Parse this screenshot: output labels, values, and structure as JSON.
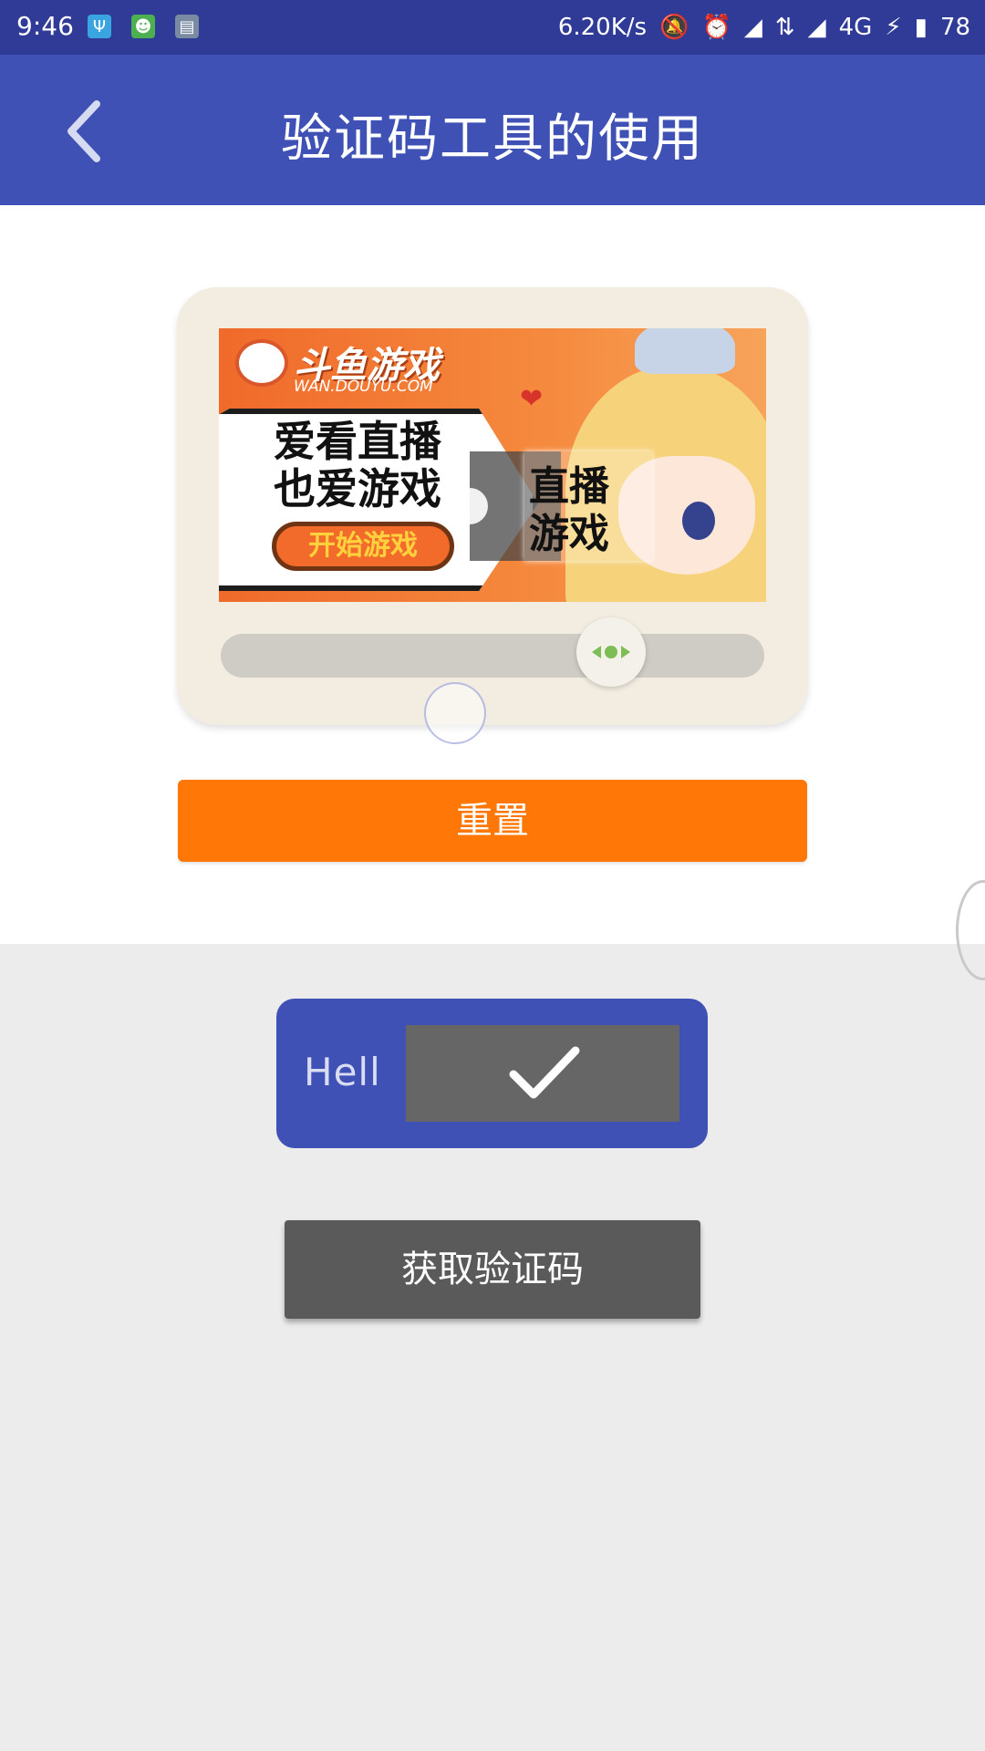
{
  "status_bar": {
    "time": "9:46",
    "network_speed": "6.20K/s",
    "network_type": "4G",
    "battery_level": "78",
    "left_icons": [
      "usb-icon",
      "android-icon",
      "screenshot-icon"
    ],
    "right_icons": [
      "mute-icon",
      "alarm-icon",
      "signal-icon",
      "data-transfer-icon",
      "signal-icon",
      "charging-icon",
      "battery-icon"
    ]
  },
  "app_bar": {
    "title": "验证码工具的使用",
    "back_icon": "chevron-left-icon",
    "color": "#3f51b5"
  },
  "captcha": {
    "logo_title": "斗鱼游戏",
    "logo_subtitle": "WAN.DOUYU.COM",
    "bubble_line1": "爱看直播",
    "bubble_line2": "也爱游戏",
    "start_label": "开始游戏",
    "piece_line1": "直播",
    "piece_line2": "游戏",
    "slider_handle_icon": "slide-arrows-icon"
  },
  "reset_button": {
    "label": "重置",
    "color": "#ff7707"
  },
  "verify_widget": {
    "text": "Hell",
    "check_icon": "checkmark-icon",
    "color": "#3f51b5"
  },
  "get_code_button": {
    "label": "获取验证码",
    "color": "#5a5a5a"
  }
}
